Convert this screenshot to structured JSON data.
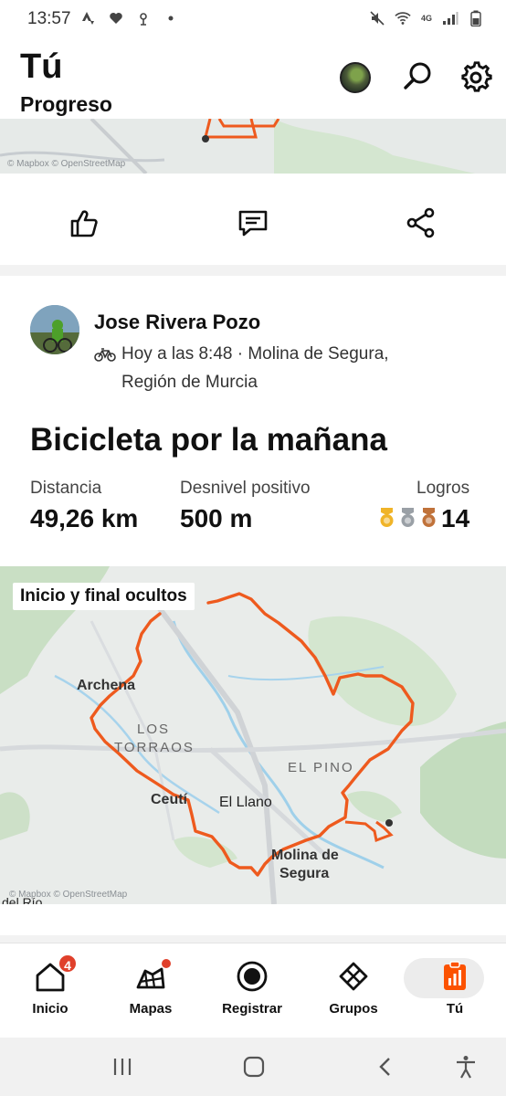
{
  "status_bar": {
    "time": "13:57",
    "network": "4G"
  },
  "header": {
    "title": "Tú",
    "subtitle": "Progreso"
  },
  "map_top": {
    "attribution": "© Mapbox © OpenStreetMap"
  },
  "activity": {
    "athlete_name": "Jose Rivera Pozo",
    "meta_line1": "Hoy a las 8:48 · Molina de Segura,",
    "meta_line2": "Región de Murcia",
    "title": "Bicicleta por la mañana",
    "stats": {
      "distance_label": "Distancia",
      "distance_value": "49,26 km",
      "elevation_label": "Desnivel positivo",
      "elevation_value": "500 m",
      "achievements_label": "Logros",
      "achievements_value": "14"
    },
    "medal_colors": [
      "#f0b428",
      "#9aa0a6",
      "#c0723a"
    ]
  },
  "map": {
    "hidden_badge": "Inicio y final ocultos",
    "attribution": "© Mapbox © OpenStreetMap",
    "route_color": "#ee5a1e",
    "places": {
      "archena": "Archena",
      "los_torraos_1": "LOS",
      "los_torraos_2": "TORRAOS",
      "el_pino": "EL PINO",
      "ceuti": "Ceutí",
      "el_llano": "El Llano",
      "molina_1": "Molina de",
      "molina_2": "Segura",
      "del_rio": "del Río"
    }
  },
  "bottom_nav": {
    "items": [
      {
        "label": "Inicio",
        "badge": "4"
      },
      {
        "label": "Mapas"
      },
      {
        "label": "Registrar"
      },
      {
        "label": "Grupos"
      },
      {
        "label": "Tú"
      }
    ],
    "accent": "#fc5200"
  }
}
